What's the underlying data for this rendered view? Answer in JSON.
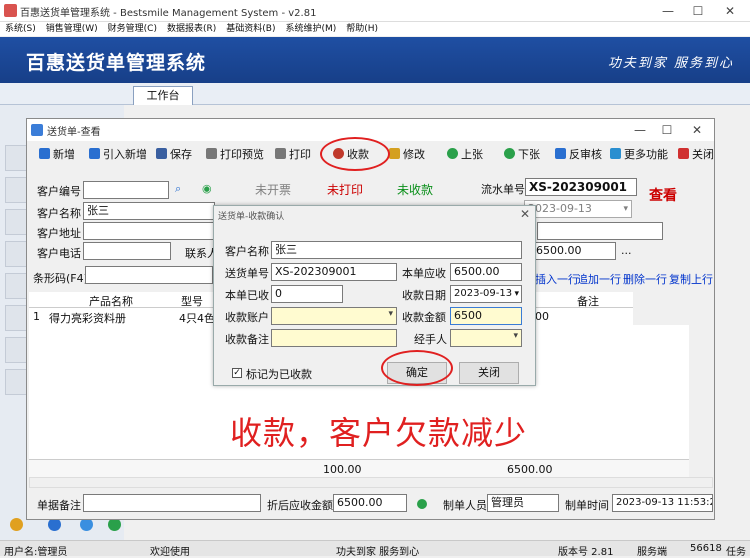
{
  "app": {
    "title": "百惠送货单管理系统 - Bestsmile Management System - v2.81",
    "menu": [
      "系统(S)",
      "销售管理(W)",
      "财务管理(C)",
      "数据报表(R)",
      "基础资料(B)",
      "系统维护(M)",
      "帮助(H)"
    ],
    "banner_title": "百惠送货单管理系统",
    "banner_slogan": "功夫到家 服务到心",
    "tab": "工作台"
  },
  "window": {
    "title": "送货单-查看",
    "toolbar": [
      "新增",
      "引入新增",
      "保存",
      "打印预览",
      "打印",
      "收款",
      "修改",
      "上张",
      "下张",
      "反审核",
      "更多功能",
      "关闭"
    ],
    "labels": {
      "customer_no": "客户编号",
      "customer_name": "客户名称",
      "customer_addr": "客户地址",
      "customer_phone": "客户电话",
      "contact": "联系人",
      "barcode": "条形码(F4)",
      "serial_no": "流水单号",
      "receivable": "应收",
      "memo": "单据备注",
      "after_discount": "折后应收金额",
      "maker": "制单人员",
      "make_time": "制单时间"
    },
    "status": {
      "invoice": "未开票",
      "print": "未打印",
      "collect": "未收款"
    },
    "values": {
      "customer_name": "张三",
      "serial_no": "XS-202309001",
      "date": "2023-09-13",
      "amount": "6500.00",
      "ellipsis": "...",
      "after_discount": "6500.00",
      "maker": "管理员",
      "make_time": "2023-09-13 11:53:24"
    },
    "view_mark": "查看",
    "row_actions": [
      "插入一行",
      "追加一行",
      "删除一行",
      "复制上行"
    ],
    "grid": {
      "headers": [
        "产品名称",
        "型号",
        "备注"
      ],
      "row": {
        "index": "1",
        "product": "得力亮彩资料册",
        "model": "4只4色6",
        "cut_value": "00"
      },
      "totals": {
        "qty": "100.00",
        "amount": "6500.00"
      }
    }
  },
  "dialog": {
    "title": "送货单-收款确认",
    "labels": {
      "customer_name": "客户名称",
      "order_no": "送货单号",
      "receivable": "本单应收",
      "already": "本单已收",
      "date": "收款日期",
      "account": "收款账户",
      "amount": "收款金额",
      "memo": "收款备注",
      "handler": "经手人"
    },
    "values": {
      "customer_name": "张三",
      "order_no": "XS-202309001",
      "receivable": "6500.00",
      "already": "0",
      "date": "2023-09-13",
      "amount": "6500"
    },
    "checkbox_label": "标记为已收款",
    "ok": "确定",
    "cancel": "关闭"
  },
  "annotation": "收款，客户欠款减少",
  "statusbar": {
    "user": "用户名:管理员",
    "welcome": "欢迎使用",
    "slogan": "功夫到家 服务到心",
    "version": "版本号 2.81",
    "service": "服务端",
    "code": "56618",
    "task": "任务"
  },
  "colors": {
    "banner": "#1f4fa3",
    "annotation": "#e02020",
    "status_red": "#cc0000",
    "status_green": "#0a8f1a"
  }
}
